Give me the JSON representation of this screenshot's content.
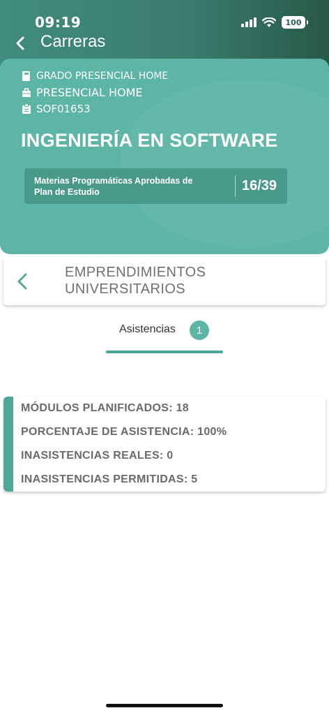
{
  "status_bar": {
    "time": "09:19",
    "battery": "100"
  },
  "nav": {
    "title": "Carreras"
  },
  "career": {
    "modality": "GRADO PRESENCIAL HOME",
    "campus": "PRESENCIAL HOME",
    "code": "SOF01653",
    "title": "INGENIERÍA EN SOFTWARE",
    "progress_label": "Materias Programáticas Aprobadas de Plan de Estudio",
    "progress_value": "16/39",
    "progress_fraction": 0.41
  },
  "subject": {
    "name": "EMPRENDIMIENTOS UNIVERSITARIOS"
  },
  "tabs": [
    {
      "label": "Asistencias",
      "badge": "1"
    }
  ],
  "attendance": {
    "planned": "MÓDULOS PLANIFICADOS: 18",
    "percentage": "PORCENTAJE DE ASISTENCIA: 100%",
    "real_absences": "INASISTENCIAS REALES: 0",
    "allowed_absences": "INASISTENCIAS PERMITIDAS: 5"
  },
  "colors": {
    "accent": "#5cb5a5",
    "header_dark": "#3a7d6f",
    "text_gray": "#6a6a6a"
  }
}
